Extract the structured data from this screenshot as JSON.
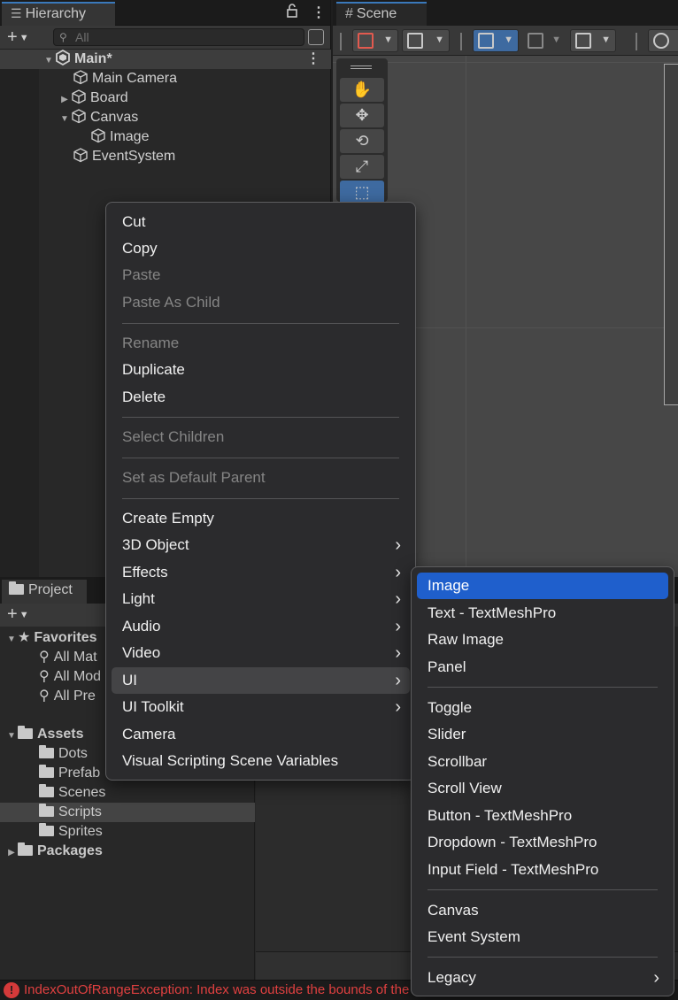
{
  "hierarchy": {
    "tab_label": "Hierarchy",
    "search_placeholder": "All",
    "scene_name": "Main*",
    "items": [
      {
        "label": "Main Camera"
      },
      {
        "label": "Board"
      },
      {
        "label": "Canvas"
      },
      {
        "label": "Image"
      },
      {
        "label": "EventSystem"
      }
    ]
  },
  "scene": {
    "tab_label": "Scene"
  },
  "project": {
    "tab_label": "Project",
    "favorites_label": "Favorites",
    "favorites": [
      "All Mat",
      "All Mod",
      "All Pre"
    ],
    "assets_label": "Assets",
    "folders": [
      "Dots",
      "Prefab",
      "Scenes",
      "Scripts",
      "Sprites"
    ],
    "packages_label": "Packages",
    "selected_folder": "Scripts"
  },
  "status": {
    "error_text": "IndexOutOfRangeException: Index was outside the bounds of the array."
  },
  "context_menu": {
    "items": [
      {
        "label": "Cut",
        "enabled": true
      },
      {
        "label": "Copy",
        "enabled": true
      },
      {
        "label": "Paste",
        "enabled": false
      },
      {
        "label": "Paste As Child",
        "enabled": false
      },
      {
        "label": "Rename",
        "enabled": false
      },
      {
        "label": "Duplicate",
        "enabled": true
      },
      {
        "label": "Delete",
        "enabled": true
      },
      {
        "label": "Select Children",
        "enabled": false
      },
      {
        "label": "Set as Default Parent",
        "enabled": false
      },
      {
        "label": "Create Empty",
        "enabled": true
      },
      {
        "label": "3D Object",
        "enabled": true,
        "submenu": true
      },
      {
        "label": "Effects",
        "enabled": true,
        "submenu": true
      },
      {
        "label": "Light",
        "enabled": true,
        "submenu": true
      },
      {
        "label": "Audio",
        "enabled": true,
        "submenu": true
      },
      {
        "label": "Video",
        "enabled": true,
        "submenu": true
      },
      {
        "label": "UI",
        "enabled": true,
        "submenu": true,
        "highlighted": true
      },
      {
        "label": "UI Toolkit",
        "enabled": true,
        "submenu": true
      },
      {
        "label": "Camera",
        "enabled": true
      },
      {
        "label": "Visual Scripting Scene Variables",
        "enabled": true
      }
    ]
  },
  "ui_submenu": {
    "items": [
      {
        "label": "Image",
        "selected": true
      },
      {
        "label": "Text - TextMeshPro"
      },
      {
        "label": "Raw Image"
      },
      {
        "label": "Panel"
      },
      {
        "label": "Toggle"
      },
      {
        "label": "Slider"
      },
      {
        "label": "Scrollbar"
      },
      {
        "label": "Scroll View"
      },
      {
        "label": "Button - TextMeshPro"
      },
      {
        "label": "Dropdown - TextMeshPro"
      },
      {
        "label": "Input Field - TextMeshPro"
      },
      {
        "label": "Canvas"
      },
      {
        "label": "Event System"
      },
      {
        "label": "Legacy",
        "submenu": true
      }
    ]
  },
  "colors": {
    "accent_blue": "#1f5fcc",
    "error_red": "#e04040"
  }
}
